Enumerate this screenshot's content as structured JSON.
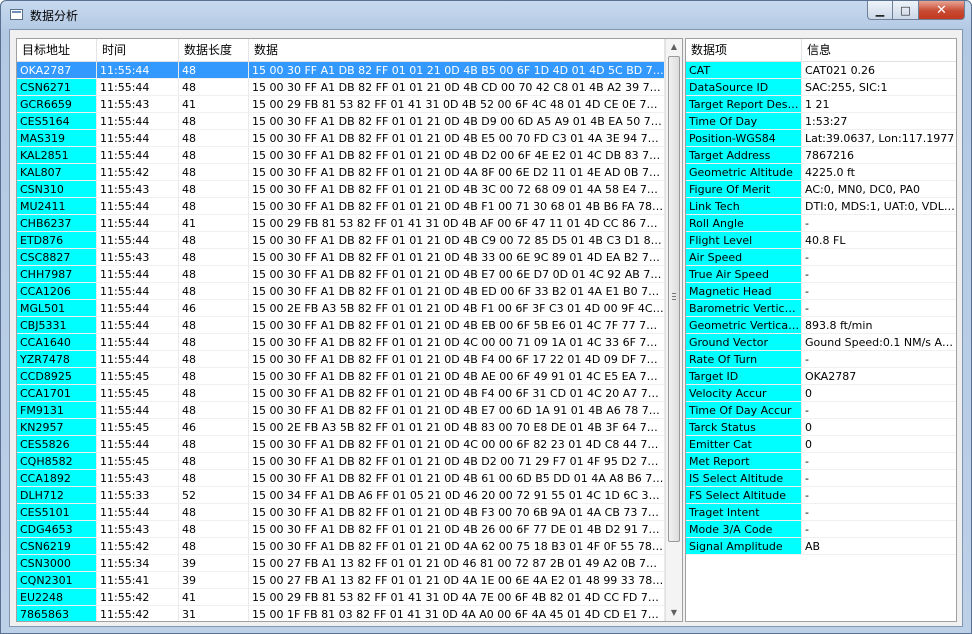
{
  "window": {
    "title": "数据分析",
    "min_icon": "minimize-icon",
    "max_icon": "maximize-icon",
    "close_icon": "close-icon"
  },
  "colors": {
    "highlight": "#00ffff",
    "selection": "#3399ff"
  },
  "left_table": {
    "columns": [
      "目标地址",
      "时间",
      "数据长度",
      "数据"
    ],
    "selected_index": 0,
    "rows": [
      [
        "OKA2787",
        "11:55:44",
        "48",
        "15 00 30 FF A1 DB 82 FF 01 01 21 0D 4B B5 00 6F 1D 4D 01 4D 5C BD 78 0B 50 ..."
      ],
      [
        "CSN6271",
        "11:55:44",
        "48",
        "15 00 30 FF A1 DB 82 FF 01 01 21 0D 4B CD 00 70 42 C8 01 4B A2 39 78 06 26 ..."
      ],
      [
        "GCR6659",
        "11:55:43",
        "41",
        "15 00 29 FB 81 53 82 FF 01 41 31 0D 4B 52 00 6F 4C 48 01 4D CE 0E 78 08 06 0..."
      ],
      [
        "CES5164",
        "11:55:44",
        "48",
        "15 00 30 FF A1 DB 82 FF 01 01 21 0D 4B D9 00 6D A5 A9 01 4B EA 50 78 03 EF ..."
      ],
      [
        "MAS319",
        "11:55:44",
        "48",
        "15 00 30 FF A1 DB 82 FF 01 01 21 0D 4B E5 00 70 FD C3 01 4A 3E 94 75 00 8C ..."
      ],
      [
        "KAL2851",
        "11:55:44",
        "48",
        "15 00 30 FF A1 DB 82 FF 01 01 21 0D 4B D2 00 6F 4E E2 01 4C DB 83 71 BC 72 ..."
      ],
      [
        "KAL807",
        "11:55:42",
        "48",
        "15 00 30 FF A1 DB 82 FF 01 01 21 0D 4A 8F 00 6E D2 11 01 4E AD 0B 71 BD 51 ..."
      ],
      [
        "CSN310",
        "11:55:43",
        "48",
        "15 00 30 FF A1 DB 82 FF 01 01 21 0D 4B 3C 00 72 68 09 01 4A 58 E4 78 06 29 0..."
      ],
      [
        "MU2411",
        "11:55:44",
        "48",
        "15 00 30 FF A1 DB 82 FF 01 01 21 0D 4B F1 00 71 30 68 01 4B B6 FA 78 09 BA 0..."
      ],
      [
        "CHB6237",
        "11:55:44",
        "41",
        "15 00 29 FB 81 53 82 FF 01 41 31 0D 4B AF 00 6F 47 11 01 4D CC 86 78 0B A7 0..."
      ],
      [
        "ETD876",
        "11:55:44",
        "48",
        "15 00 30 FF A1 DB 82 FF 01 01 21 0D 4B C9 00 72 85 D5 01 4B C3 D1 89 61 B2 ..."
      ],
      [
        "CSC8827",
        "11:55:43",
        "48",
        "15 00 30 FF A1 DB 82 FF 01 01 21 0D 4B 33 00 6E 9C 89 01 4D EA B2 78 07 35 0..."
      ],
      [
        "CHH7987",
        "11:55:44",
        "48",
        "15 00 30 FF A1 DB 82 FF 01 01 21 0D 4B E7 00 6E D7 0D 01 4C 92 AB 78 00 1B ..."
      ],
      [
        "CCA1206",
        "11:55:44",
        "48",
        "15 00 30 FF A1 DB 82 FF 01 01 21 0D 4B ED 00 6F 33 B2 01 4A E1 B0 78 03 F5 0..."
      ],
      [
        "MGL501",
        "11:55:44",
        "46",
        "15 00 2E FB A3 5B 82 FF 01 01 21 0D 4B F1 00 6F 3F C3 01 4D 00 9F 4C A1 AA ..."
      ],
      [
        "CBJ5331",
        "11:55:44",
        "48",
        "15 00 30 FF A1 DB 82 FF 01 01 21 0D 4B EB 00 6F 5B E6 01 4C 7F 77 78 00 D5 0..."
      ],
      [
        "CCA1640",
        "11:55:44",
        "48",
        "15 00 30 FF A1 DB 82 FF 01 01 21 0D 4C 00 00 71 09 1A 01 4C 33 6F 78 04 91 0..."
      ],
      [
        "YZR7478",
        "11:55:44",
        "48",
        "15 00 30 FF A1 DB 82 FF 01 01 21 0D 4B F4 00 6F 17 22 01 4D 09 DF 78 05 3B 0..."
      ],
      [
        "CCD8925",
        "11:55:45",
        "48",
        "15 00 30 FF A1 DB 82 FF 01 01 21 0D 4B AE 00 6F 49 91 01 4C E5 EA 78 08 72 1..."
      ],
      [
        "CCA1701",
        "11:55:45",
        "48",
        "15 00 30 FF A1 DB 82 FF 01 01 21 0D 4B F4 00 6F 31 CD 01 4C 20 A7 78 08 69 ..."
      ],
      [
        "FM9131",
        "11:55:44",
        "48",
        "15 00 30 FF A1 DB 82 FF 01 01 21 0D 4B E7 00 6D 1A 91 01 4B A6 78 78 03 54 0..."
      ],
      [
        "KN2957",
        "11:55:45",
        "46",
        "15 00 2E FB A3 5B 82 FF 01 01 21 0D 4B 83 00 70 E8 DE 01 4B 3F 64 78 08 97 0..."
      ],
      [
        "CES5826",
        "11:55:44",
        "48",
        "15 00 30 FF A1 DB 82 FF 01 01 21 0D 4C 00 00 6F 82 23 01 4D C8 44 78 00 59 0..."
      ],
      [
        "CQH8582",
        "11:55:45",
        "48",
        "15 00 30 FF A1 DB 82 FF 01 01 21 0D 4B D2 00 71 29 F7 01 4F 95 D2 78 07 B2 0..."
      ],
      [
        "CCA1892",
        "11:55:43",
        "48",
        "15 00 30 FF A1 DB 82 FF 01 01 21 0D 4B 61 00 6D B5 DD 01 4A A8 B6 78 05 25 ..."
      ],
      [
        "DLH712",
        "11:55:33",
        "52",
        "15 00 34 FF A1 DB A6 FF 01 05 21 0D 46 20 00 72 91 55 01 4C 1D 6C 3C 4B 29 ..."
      ],
      [
        "CES5101",
        "11:55:44",
        "48",
        "15 00 30 FF A1 DB 82 FF 01 01 21 0D 4B F3 00 70 6B 9A 01 4A CB 73 78 04 5E ..."
      ],
      [
        "CDG4653",
        "11:55:43",
        "48",
        "15 00 30 FF A1 DB 82 FF 01 01 21 0D 4B 26 00 6F 77 DE 01 4B D2 91 78 0B 04 0..."
      ],
      [
        "CSN6219",
        "11:55:42",
        "48",
        "15 00 30 FF A1 DB 82 FF 01 01 21 0D 4A 62 00 75 18 B3 01 4F 0F 55 78 02 4C 0..."
      ],
      [
        "CSN3000",
        "11:55:34",
        "39",
        "15 00 27 FB A1 13 82 FF 01 01 21 0D 46 81 00 72 87 2B 01 49 A2 0B 78 07 BC 4..."
      ],
      [
        "CQN2301",
        "11:55:41",
        "39",
        "15 00 27 FB A1 13 82 FF 01 01 21 0D 4A 1E 00 6E 4A E2 01 48 99 33 78 0B 8A 0..."
      ],
      [
        "EU2248",
        "11:55:42",
        "41",
        "15 00 29 FB 81 53 82 FF 01 41 31 0D 4A 7E 00 6F 4B 82 01 4D CC FD 78 03 55 0..."
      ],
      [
        "7865863",
        "11:55:42",
        "31",
        "15 00 1F FB 81 03 82 FF 01 41 31 0D 4A A0 00 6F 4A 45 01 4D CD E1 78 06 07 ..."
      ]
    ]
  },
  "right_table": {
    "columns": [
      "数据项",
      "信息"
    ],
    "rows": [
      [
        "CAT",
        "CAT021 0.26"
      ],
      [
        "DataSource ID",
        "SAC:255, SIC:1"
      ],
      [
        "Target Report Desc...",
        "1 21"
      ],
      [
        "Time Of Day",
        "1:53:27"
      ],
      [
        "Position-WGS84",
        "Lat:39.0637, Lon:117.1977"
      ],
      [
        "Target Address",
        "7867216"
      ],
      [
        "Geometric Altitude",
        "4225.0 ft"
      ],
      [
        "Figure Of Merit",
        "AC:0, MN0, DC0, PA0"
      ],
      [
        "Link Tech",
        "DTI:0, MDS:1, UAT:0, VDL:..."
      ],
      [
        "Roll Angle",
        "-"
      ],
      [
        "Flight Level",
        "40.8 FL"
      ],
      [
        "Air Speed",
        "-"
      ],
      [
        "True Air Speed",
        "-"
      ],
      [
        "Magnetic Head",
        "-"
      ],
      [
        "Barometric Vertical ...",
        "-"
      ],
      [
        "Geometric Vertical R...",
        "893.8 ft/min"
      ],
      [
        "Ground Vector",
        "Gound Speed:0.1 NM/s Azi..."
      ],
      [
        "Rate Of Turn",
        "-"
      ],
      [
        "Target ID",
        "OKA2787"
      ],
      [
        "Velocity Accur",
        "0"
      ],
      [
        "Time Of Day Accur",
        "-"
      ],
      [
        "Tarck Status",
        "0"
      ],
      [
        "Emitter Cat",
        "0"
      ],
      [
        "Met Report",
        "-"
      ],
      [
        "IS Select Altitude",
        "-"
      ],
      [
        "FS Select Altitude",
        "-"
      ],
      [
        "Traget Intent",
        "-"
      ],
      [
        "Mode 3/A Code",
        "-"
      ],
      [
        "Signal Amplitude",
        "AB"
      ]
    ]
  }
}
